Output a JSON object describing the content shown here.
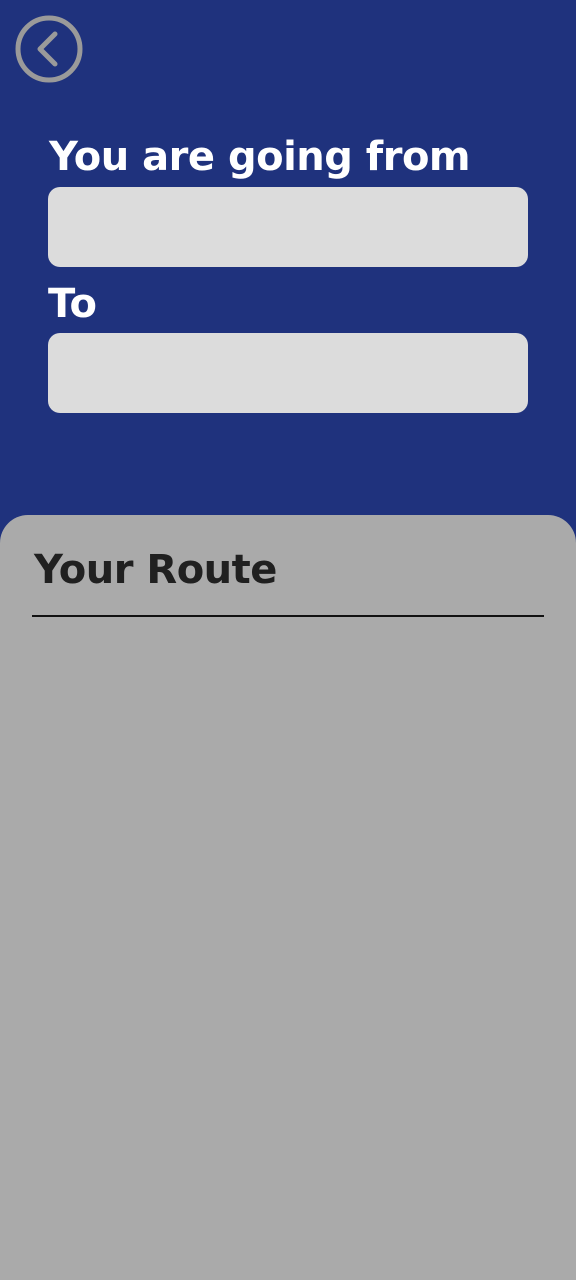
{
  "header": {
    "back_icon": "chevron-left-circle-icon",
    "from_label": "You are going from",
    "to_label": "To"
  },
  "inputs": {
    "from": {
      "value": "",
      "placeholder": ""
    },
    "to": {
      "value": "",
      "placeholder": ""
    }
  },
  "route": {
    "title": "Your Route"
  },
  "colors": {
    "header_background": "#1f327d",
    "input_background": "#dcdcdc",
    "panel_background": "#aaaaaa",
    "text_light": "#ffffff",
    "text_dark": "#202020",
    "icon_gray": "#9a9a9a"
  }
}
